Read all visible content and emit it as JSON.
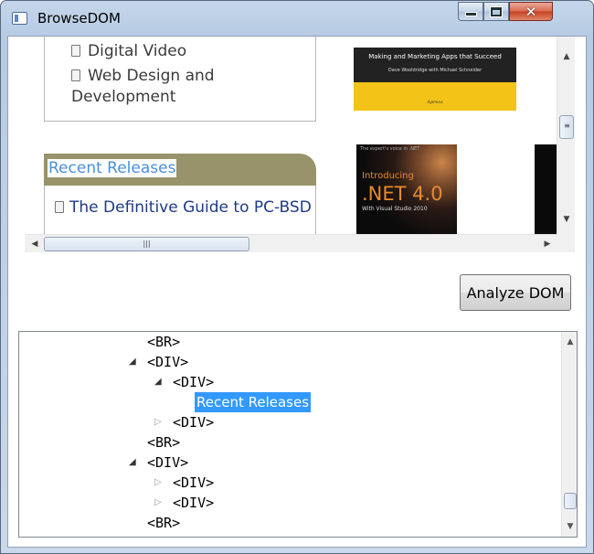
{
  "window": {
    "title": "BrowseDOM",
    "minimize_icon": "minimize-icon",
    "maximize_icon": "maximize-icon",
    "close_icon": "close-icon",
    "close_symbol": "✕"
  },
  "browser": {
    "nav_items": [
      "Digital Video",
      "Web Design and",
      "Development"
    ],
    "book1": {
      "title": "Making and Marketing Apps that Succeed",
      "authors": "Dave Wooldridge with Michael Schneider",
      "publisher": "Apress"
    },
    "recent_header": "Recent Releases",
    "recent_link": "The Definitive Guide to PC-BSD",
    "book2": {
      "top_text": "The expert's voice in .NET",
      "title_line1": "Introducing",
      "title_line2": ".NET 4.0",
      "subtitle": "With Visual Studio 2010"
    },
    "scroll_grip": "|||",
    "accent_color": "#98936a",
    "link_color": "#1f3a86"
  },
  "analyze_button": {
    "label": "Analyze DOM"
  },
  "dom_tree": {
    "nodes": [
      {
        "label": "<BR>",
        "expander": ""
      },
      {
        "label": "<DIV>",
        "expander": "◢"
      },
      {
        "label": "<DIV>",
        "expander": "◢"
      },
      {
        "label": "Recent Releases",
        "expander": ""
      },
      {
        "label": "<DIV>",
        "expander": "▷"
      },
      {
        "label": "<BR>",
        "expander": ""
      },
      {
        "label": "<DIV>",
        "expander": "◢"
      },
      {
        "label": "<DIV>",
        "expander": "▷"
      },
      {
        "label": "<DIV>",
        "expander": "▷"
      },
      {
        "label": "<BR>",
        "expander": ""
      }
    ],
    "selection_color": "#3399ff"
  }
}
